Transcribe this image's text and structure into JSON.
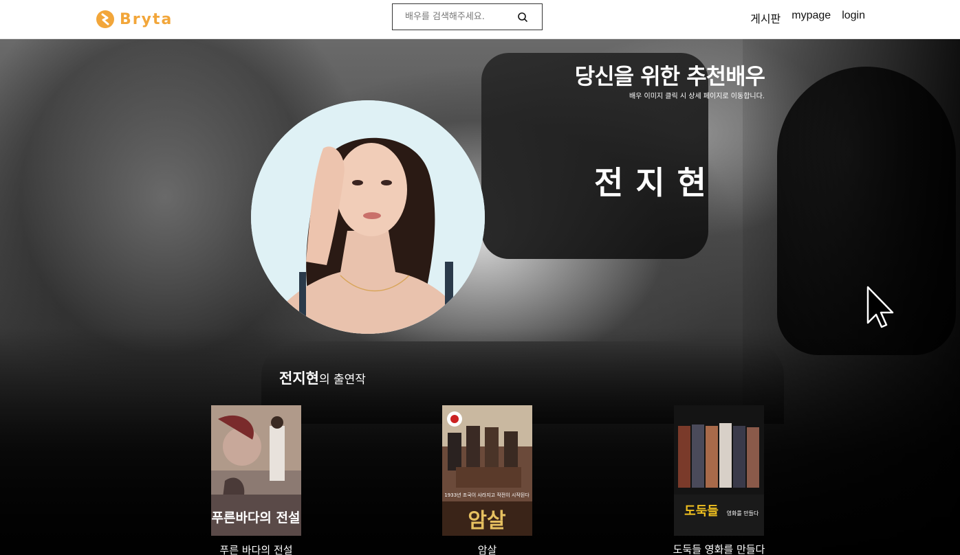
{
  "brand": {
    "name": "Bryta",
    "color": "#f2a63a"
  },
  "search": {
    "placeholder": "배우를 검색해주세요.",
    "icon": "search-icon"
  },
  "nav": [
    {
      "label": "게시판"
    },
    {
      "label": "mypage"
    },
    {
      "label": "login"
    }
  ],
  "hero": {
    "title": "당신을 위한 추천배우",
    "subtitle": "배우 이미지 클릭 시 상세 페이지로 이동합니다.",
    "actor_name": "전지현"
  },
  "filmography": {
    "heading_name": "전지현",
    "heading_suffix": "의 출연작",
    "films": [
      {
        "title": "푸른 바다의 전설",
        "poster_text": "푸른바다의 전설"
      },
      {
        "title": "암살",
        "poster_text": "암살",
        "poster_tagline": "1933년 조국이 사라지고 작전이 시작된다"
      },
      {
        "title": "도둑들 영화를 만들다",
        "poster_text": "도둑들",
        "poster_tagline": "영화를 만들다"
      }
    ]
  }
}
